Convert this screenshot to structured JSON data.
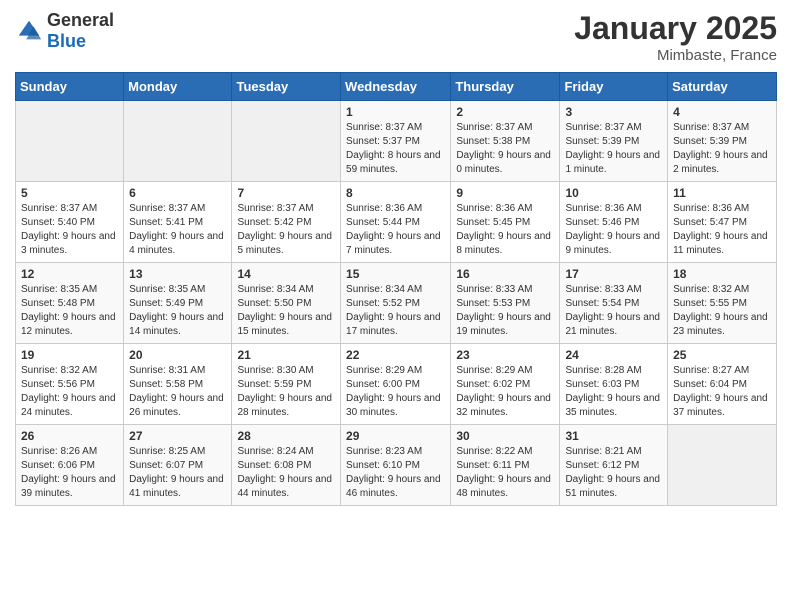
{
  "logo": {
    "general": "General",
    "blue": "Blue"
  },
  "header": {
    "month": "January 2025",
    "location": "Mimbaste, France"
  },
  "weekdays": [
    "Sunday",
    "Monday",
    "Tuesday",
    "Wednesday",
    "Thursday",
    "Friday",
    "Saturday"
  ],
  "weeks": [
    [
      {
        "day": "",
        "sunrise": "",
        "sunset": "",
        "daylight": ""
      },
      {
        "day": "",
        "sunrise": "",
        "sunset": "",
        "daylight": ""
      },
      {
        "day": "",
        "sunrise": "",
        "sunset": "",
        "daylight": ""
      },
      {
        "day": "1",
        "sunrise": "Sunrise: 8:37 AM",
        "sunset": "Sunset: 5:37 PM",
        "daylight": "Daylight: 8 hours and 59 minutes."
      },
      {
        "day": "2",
        "sunrise": "Sunrise: 8:37 AM",
        "sunset": "Sunset: 5:38 PM",
        "daylight": "Daylight: 9 hours and 0 minutes."
      },
      {
        "day": "3",
        "sunrise": "Sunrise: 8:37 AM",
        "sunset": "Sunset: 5:39 PM",
        "daylight": "Daylight: 9 hours and 1 minute."
      },
      {
        "day": "4",
        "sunrise": "Sunrise: 8:37 AM",
        "sunset": "Sunset: 5:39 PM",
        "daylight": "Daylight: 9 hours and 2 minutes."
      }
    ],
    [
      {
        "day": "5",
        "sunrise": "Sunrise: 8:37 AM",
        "sunset": "Sunset: 5:40 PM",
        "daylight": "Daylight: 9 hours and 3 minutes."
      },
      {
        "day": "6",
        "sunrise": "Sunrise: 8:37 AM",
        "sunset": "Sunset: 5:41 PM",
        "daylight": "Daylight: 9 hours and 4 minutes."
      },
      {
        "day": "7",
        "sunrise": "Sunrise: 8:37 AM",
        "sunset": "Sunset: 5:42 PM",
        "daylight": "Daylight: 9 hours and 5 minutes."
      },
      {
        "day": "8",
        "sunrise": "Sunrise: 8:36 AM",
        "sunset": "Sunset: 5:44 PM",
        "daylight": "Daylight: 9 hours and 7 minutes."
      },
      {
        "day": "9",
        "sunrise": "Sunrise: 8:36 AM",
        "sunset": "Sunset: 5:45 PM",
        "daylight": "Daylight: 9 hours and 8 minutes."
      },
      {
        "day": "10",
        "sunrise": "Sunrise: 8:36 AM",
        "sunset": "Sunset: 5:46 PM",
        "daylight": "Daylight: 9 hours and 9 minutes."
      },
      {
        "day": "11",
        "sunrise": "Sunrise: 8:36 AM",
        "sunset": "Sunset: 5:47 PM",
        "daylight": "Daylight: 9 hours and 11 minutes."
      }
    ],
    [
      {
        "day": "12",
        "sunrise": "Sunrise: 8:35 AM",
        "sunset": "Sunset: 5:48 PM",
        "daylight": "Daylight: 9 hours and 12 minutes."
      },
      {
        "day": "13",
        "sunrise": "Sunrise: 8:35 AM",
        "sunset": "Sunset: 5:49 PM",
        "daylight": "Daylight: 9 hours and 14 minutes."
      },
      {
        "day": "14",
        "sunrise": "Sunrise: 8:34 AM",
        "sunset": "Sunset: 5:50 PM",
        "daylight": "Daylight: 9 hours and 15 minutes."
      },
      {
        "day": "15",
        "sunrise": "Sunrise: 8:34 AM",
        "sunset": "Sunset: 5:52 PM",
        "daylight": "Daylight: 9 hours and 17 minutes."
      },
      {
        "day": "16",
        "sunrise": "Sunrise: 8:33 AM",
        "sunset": "Sunset: 5:53 PM",
        "daylight": "Daylight: 9 hours and 19 minutes."
      },
      {
        "day": "17",
        "sunrise": "Sunrise: 8:33 AM",
        "sunset": "Sunset: 5:54 PM",
        "daylight": "Daylight: 9 hours and 21 minutes."
      },
      {
        "day": "18",
        "sunrise": "Sunrise: 8:32 AM",
        "sunset": "Sunset: 5:55 PM",
        "daylight": "Daylight: 9 hours and 23 minutes."
      }
    ],
    [
      {
        "day": "19",
        "sunrise": "Sunrise: 8:32 AM",
        "sunset": "Sunset: 5:56 PM",
        "daylight": "Daylight: 9 hours and 24 minutes."
      },
      {
        "day": "20",
        "sunrise": "Sunrise: 8:31 AM",
        "sunset": "Sunset: 5:58 PM",
        "daylight": "Daylight: 9 hours and 26 minutes."
      },
      {
        "day": "21",
        "sunrise": "Sunrise: 8:30 AM",
        "sunset": "Sunset: 5:59 PM",
        "daylight": "Daylight: 9 hours and 28 minutes."
      },
      {
        "day": "22",
        "sunrise": "Sunrise: 8:29 AM",
        "sunset": "Sunset: 6:00 PM",
        "daylight": "Daylight: 9 hours and 30 minutes."
      },
      {
        "day": "23",
        "sunrise": "Sunrise: 8:29 AM",
        "sunset": "Sunset: 6:02 PM",
        "daylight": "Daylight: 9 hours and 32 minutes."
      },
      {
        "day": "24",
        "sunrise": "Sunrise: 8:28 AM",
        "sunset": "Sunset: 6:03 PM",
        "daylight": "Daylight: 9 hours and 35 minutes."
      },
      {
        "day": "25",
        "sunrise": "Sunrise: 8:27 AM",
        "sunset": "Sunset: 6:04 PM",
        "daylight": "Daylight: 9 hours and 37 minutes."
      }
    ],
    [
      {
        "day": "26",
        "sunrise": "Sunrise: 8:26 AM",
        "sunset": "Sunset: 6:06 PM",
        "daylight": "Daylight: 9 hours and 39 minutes."
      },
      {
        "day": "27",
        "sunrise": "Sunrise: 8:25 AM",
        "sunset": "Sunset: 6:07 PM",
        "daylight": "Daylight: 9 hours and 41 minutes."
      },
      {
        "day": "28",
        "sunrise": "Sunrise: 8:24 AM",
        "sunset": "Sunset: 6:08 PM",
        "daylight": "Daylight: 9 hours and 44 minutes."
      },
      {
        "day": "29",
        "sunrise": "Sunrise: 8:23 AM",
        "sunset": "Sunset: 6:10 PM",
        "daylight": "Daylight: 9 hours and 46 minutes."
      },
      {
        "day": "30",
        "sunrise": "Sunrise: 8:22 AM",
        "sunset": "Sunset: 6:11 PM",
        "daylight": "Daylight: 9 hours and 48 minutes."
      },
      {
        "day": "31",
        "sunrise": "Sunrise: 8:21 AM",
        "sunset": "Sunset: 6:12 PM",
        "daylight": "Daylight: 9 hours and 51 minutes."
      },
      {
        "day": "",
        "sunrise": "",
        "sunset": "",
        "daylight": ""
      }
    ]
  ]
}
